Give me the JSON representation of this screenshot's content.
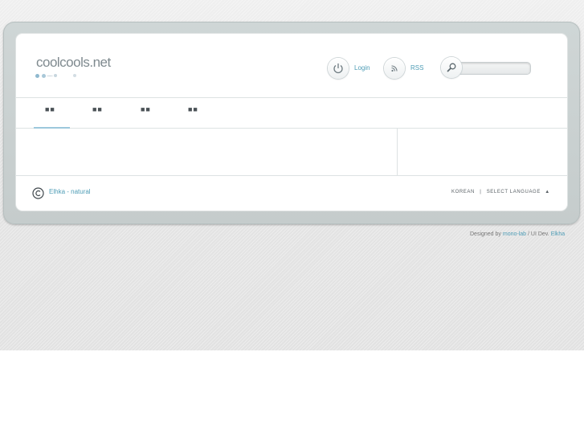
{
  "header": {
    "logo_text": "coolcools.net",
    "login_label": "Login",
    "rss_label": "RSS",
    "search": {
      "value": "",
      "placeholder": ""
    }
  },
  "nav": {
    "items": [
      {
        "label": "■■"
      },
      {
        "label": "■■"
      },
      {
        "label": "■■"
      },
      {
        "label": "■■"
      }
    ],
    "active_index": 0
  },
  "footer": {
    "copyright_text": "Elhka - natural",
    "language_current": "KOREAN",
    "language_separator": "|",
    "language_select_label": "SELECT LANGUAGE",
    "language_arrow": "▲"
  },
  "credit": {
    "prefix": "Designed by",
    "designer": "mono-lab",
    "middle": "/ UI Dev.",
    "developer": "Elkha"
  },
  "colors": {
    "accent": "#4f9db6",
    "nav_active": "#9cc8dc",
    "logo": "#7f8a8f"
  },
  "icons": [
    "power-icon",
    "rss-icon",
    "search-icon",
    "copyright-icon",
    "triangle-up-icon"
  ]
}
